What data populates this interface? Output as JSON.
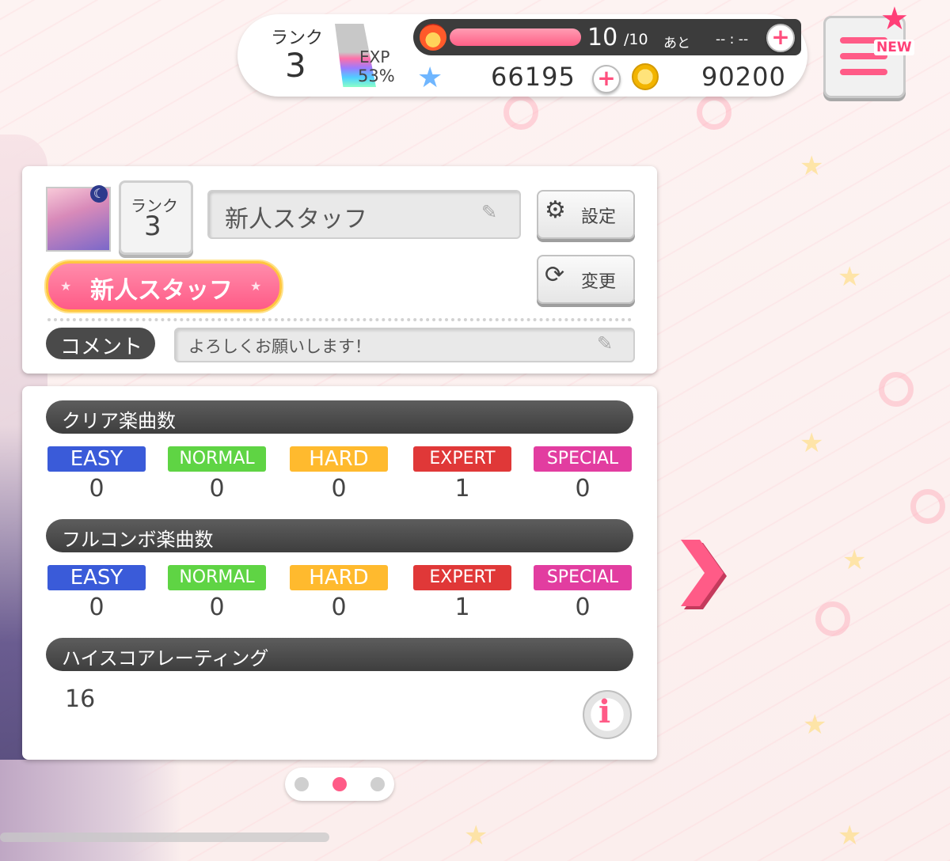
{
  "header": {
    "rank_label": "ランク",
    "rank_value": "3",
    "exp_label": "EXP",
    "exp_value": "53%",
    "stamina_current": "10",
    "stamina_max": "/10",
    "stamina_ato": "あと",
    "stamina_time": "-- : --",
    "stamina_fraction": 1.0,
    "stars": "66195",
    "coins": "90200",
    "menu_new_badge": "NEW",
    "accent_color": "#ff5b87"
  },
  "profile": {
    "rank_label": "ランク",
    "rank_value": "3",
    "player_name": "新人スタッフ",
    "title_badge": "新人スタッフ",
    "settings_label": "設定",
    "change_label": "変更",
    "comment_label": "コメント",
    "comment_text": "よろしくお願いします！"
  },
  "stats": {
    "clear_title": "クリア楽曲数",
    "fullcombo_title": "フルコンボ楽曲数",
    "rating_title": "ハイスコアレーティング",
    "rating_value": "16",
    "difficulties": [
      {
        "label": "EASY",
        "color": "#3a5bd9"
      },
      {
        "label": "NORMAL",
        "color": "#5fd444"
      },
      {
        "label": "HARD",
        "color": "#ffba2e"
      },
      {
        "label": "EXPERT",
        "color": "#e03838"
      },
      {
        "label": "SPECIAL",
        "color": "#e23da0"
      }
    ],
    "clear_counts": [
      "0",
      "0",
      "0",
      "1",
      "0"
    ],
    "fullcombo_counts": [
      "0",
      "0",
      "0",
      "1",
      "0"
    ]
  },
  "pager": {
    "total": 3,
    "active": 2
  }
}
